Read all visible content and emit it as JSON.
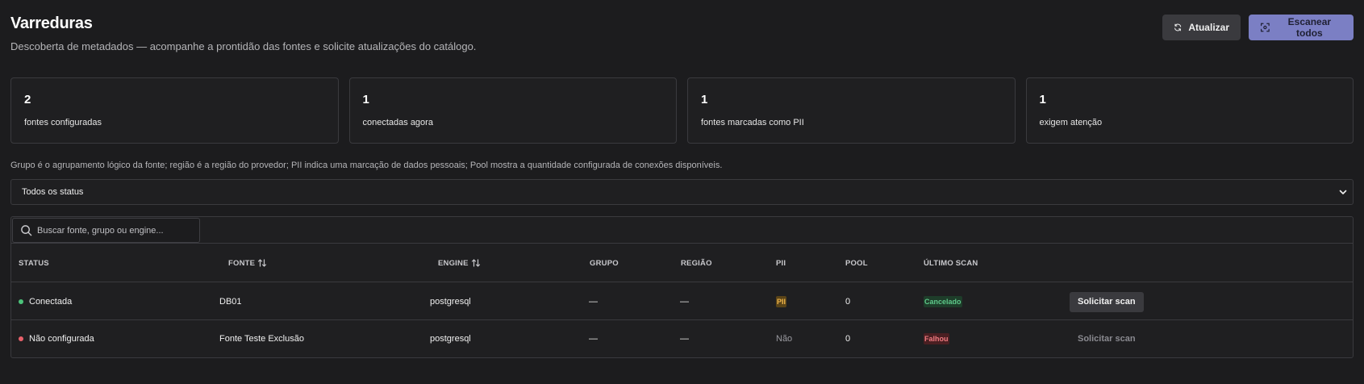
{
  "header": {
    "title": "Varreduras",
    "subtitle": "Descoberta de metadados — acompanhe a prontidão das fontes e solicite atualizações do catálogo."
  },
  "actions": {
    "refresh_label": "Atualizar",
    "scan_all_label": "Escanear todos",
    "refresh_icon": "refresh-icon",
    "scan_icon": "scan-icon"
  },
  "stats": [
    {
      "value": "2",
      "label": "fontes configuradas"
    },
    {
      "value": "1",
      "label": "conectadas agora"
    },
    {
      "value": "1",
      "label": "fontes marcadas como PII"
    },
    {
      "value": "1",
      "label": "exigem atenção"
    }
  ],
  "legend": "Grupo é o agrupamento lógico da fonte; região é a região do provedor; PII indica uma marcação de dados pessoais; Pool mostra a quantidade configurada de conexões disponíveis.",
  "status_filter": {
    "selected": "Todos os status"
  },
  "search": {
    "placeholder": "Buscar fonte, grupo ou engine..."
  },
  "table": {
    "columns": {
      "status": "STATUS",
      "fonte": "FONTE",
      "engine": "ENGINE",
      "grupo": "GRUPO",
      "regiao": "REGIÃO",
      "pii": "PII",
      "pool": "POOL",
      "ultimo_scan": "ÚLTIMO SCAN"
    },
    "rows": [
      {
        "status": "Conectada",
        "status_color": "#4cc37a",
        "fonte": "DB01",
        "engine": "postgresql",
        "grupo": "—",
        "regiao": "—",
        "pii": "PII",
        "pool": "0",
        "ultimo_scan": "Cancelado",
        "action": "Solicitar scan"
      },
      {
        "status": "Não configurada",
        "status_color": "#e8606a",
        "fonte": "Fonte Teste Exclusão",
        "engine": "postgresql",
        "grupo": "—",
        "regiao": "—",
        "pii": "Não",
        "pool": "0",
        "ultimo_scan": "Falhou",
        "action": "Solicitar scan"
      }
    ]
  },
  "colors": {
    "background": "#1c1c1e",
    "accent": "#7b7fc4",
    "connected": "#4cc37a",
    "not_configured": "#e8606a"
  }
}
